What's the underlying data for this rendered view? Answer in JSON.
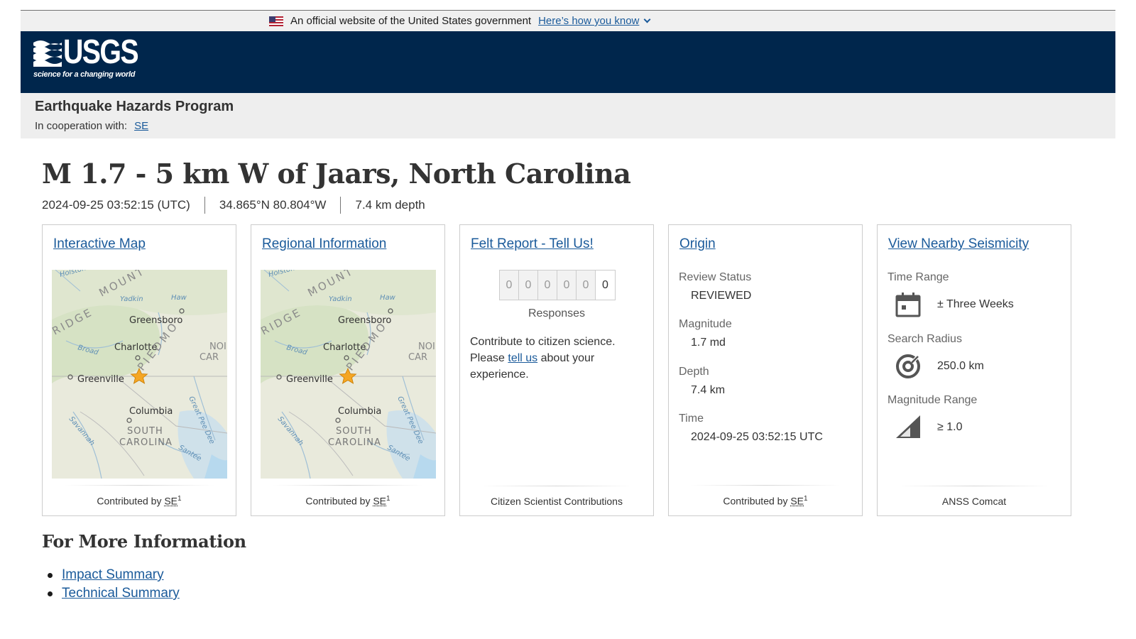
{
  "gov_banner": {
    "text": "An official website of the United States government",
    "link": "Here’s how you know"
  },
  "header": {
    "logo_word": "USGS",
    "logo_tagline": "science for a changing world"
  },
  "program": {
    "title": "Earthquake Hazards Program",
    "coop_label": "In cooperation with:",
    "coop_link": "SE"
  },
  "event": {
    "title": "M 1.7 - 5 km W of Jaars, North Carolina",
    "time": "2024-09-25 03:52:15 (UTC)",
    "location": "34.865°N 80.804°W",
    "depth": "7.4 km depth"
  },
  "cards": {
    "map": {
      "title": "Interactive Map",
      "contributed_by": "Contributed by",
      "contributor": "SE",
      "footnote": "1",
      "map_labels": {
        "greensboro": "Greensboro",
        "charlotte": "Charlotte",
        "greenville": "Greenville",
        "columbia": "Columbia",
        "south": "SOUTH",
        "carolina": "CAROLINA",
        "ridge": "RIDGE",
        "mount": "MOUNT",
        "piedmont": "PIEDMO",
        "yadkin": "Yadkin",
        "haw": "Haw",
        "broad": "Broad",
        "savannah": "Savannah",
        "great_pee_dee": "Great Pee Dee",
        "santee": "Santee",
        "holston": "Holston",
        "nor": "NOI",
        "car": "CAR"
      }
    },
    "regional": {
      "title": "Regional Information",
      "contributed_by": "Contributed by",
      "contributor": "SE",
      "footnote": "1"
    },
    "felt": {
      "title": "Felt Report - Tell Us!",
      "digits": [
        "0",
        "0",
        "0",
        "0",
        "0",
        "0"
      ],
      "responses_label": "Responses",
      "text_before": "Contribute to citizen science. Please ",
      "link": "tell us",
      "text_after": " about your experience.",
      "footer": "Citizen Scientist Contributions"
    },
    "origin": {
      "title": "Origin",
      "review_status_label": "Review Status",
      "review_status": "REVIEWED",
      "magnitude_label": "Magnitude",
      "magnitude": "1.7 md",
      "depth_label": "Depth",
      "depth": "7.4 km",
      "time_label": "Time",
      "time": "2024-09-25 03:52:15 UTC",
      "contributed_by": "Contributed by",
      "contributor": "SE",
      "footnote": "1"
    },
    "nearby": {
      "title": "View Nearby Seismicity",
      "time_range_label": "Time Range",
      "time_range": "± Three Weeks",
      "search_radius_label": "Search Radius",
      "search_radius": "250.0 km",
      "magnitude_range_label": "Magnitude Range",
      "magnitude_range": "≥ 1.0",
      "footer": "ANSS Comcat",
      "icons": [
        "calendar-icon",
        "radius-target-icon",
        "magnitude-wedge-icon"
      ]
    }
  },
  "more_info": {
    "heading": "For More Information",
    "links": [
      "Impact Summary",
      "Technical Summary"
    ]
  },
  "colors": {
    "header_bg": "#00264c",
    "link": "#1a5a9a",
    "epicenter_star": "#f5a623",
    "icon_gray": "#555555"
  }
}
